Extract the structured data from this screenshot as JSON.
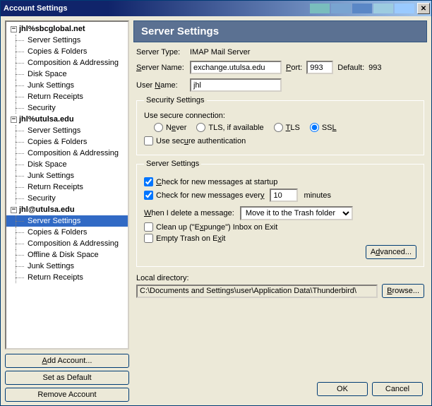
{
  "window": {
    "title": "Account Settings"
  },
  "sidebar": {
    "accounts": [
      {
        "name": "jhl%sbcglobal.net",
        "expanded": true,
        "items": [
          "Server Settings",
          "Copies & Folders",
          "Composition & Addressing",
          "Disk Space",
          "Junk Settings",
          "Return Receipts",
          "Security"
        ]
      },
      {
        "name": "jhl%utulsa.edu",
        "expanded": true,
        "items": [
          "Server Settings",
          "Copies & Folders",
          "Composition & Addressing",
          "Disk Space",
          "Junk Settings",
          "Return Receipts",
          "Security"
        ]
      },
      {
        "name": "jhl@utulsa.edu",
        "expanded": true,
        "items": [
          "Server Settings",
          "Copies & Folders",
          "Composition & Addressing",
          "Offline & Disk Space",
          "Junk Settings",
          "Return Receipts"
        ],
        "selected_index": 0
      }
    ],
    "buttons": {
      "add": "Add Account...",
      "default": "Set as Default",
      "remove": "Remove Account"
    }
  },
  "main": {
    "title": "Server Settings",
    "server_type_label": "Server Type:",
    "server_type": "IMAP Mail Server",
    "server_name_label": "Server Name:",
    "server_name": "exchange.utulsa.edu",
    "port_label": "Port:",
    "port": "993",
    "default_label": "Default:",
    "default_port": "993",
    "user_name_label": "User Name:",
    "user_name": "jhl",
    "security": {
      "legend": "Security Settings",
      "use_secure_label": "Use secure connection:",
      "options": [
        "Never",
        "TLS, if available",
        "TLS",
        "SSL"
      ],
      "selected": 3,
      "use_auth": "Use secure authentication"
    },
    "server_settings": {
      "legend": "Server Settings",
      "check_startup": "Check for new messages at startup",
      "check_every_pre": "Check for new messages every",
      "check_interval": "10",
      "check_every_post": "minutes",
      "delete_label": "When I delete a message:",
      "delete_options": [
        "Move it to the Trash folder"
      ],
      "cleanup": "Clean up (\"Expunge\") Inbox on Exit",
      "empty_trash": "Empty Trash on Exit",
      "advanced": "Advanced..."
    },
    "local_dir_label": "Local directory:",
    "local_dir": "C:\\Documents and Settings\\user\\Application Data\\Thunderbird\\",
    "browse": "Browse..."
  },
  "footer": {
    "ok": "OK",
    "cancel": "Cancel"
  },
  "titlebar_colors": [
    "#79bdbd",
    "#79a4d1",
    "#5a87c6",
    "#9dcce0",
    "#9acaff"
  ]
}
